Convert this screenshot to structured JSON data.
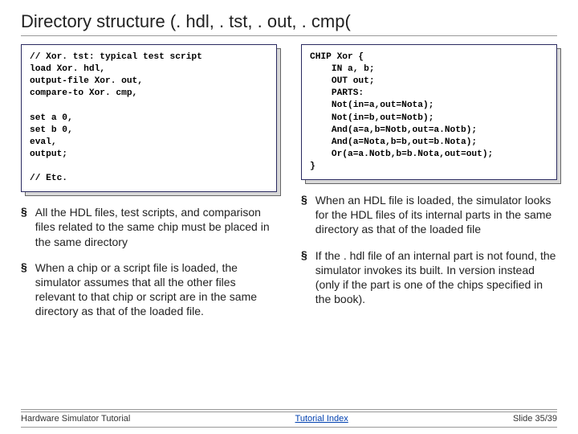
{
  "title": "Directory structure (. hdl, . tst, . out, . cmp(",
  "code_left": "// Xor. tst: typical test script\nload Xor. hdl,\noutput-file Xor. out,\ncompare-to Xor. cmp,\n\nset a 0,\nset b 0,\neval,\noutput;\n\n// Etc.",
  "code_right": "CHIP Xor {\n    IN a, b;\n    OUT out;\n    PARTS:\n    Not(in=a,out=Nota);\n    Not(in=b,out=Notb);\n    And(a=a,b=Notb,out=a.Notb);\n    And(a=Nota,b=b,out=b.Nota);\n    Or(a=a.Notb,b=b.Nota,out=out);\n}",
  "bullets_left": [
    "All the HDL files, test scripts, and comparison files related to the same chip must be placed in the same directory",
    "When a chip or a script file is loaded, the simulator assumes that all the other files relevant to that chip or script are in the same directory as that of the loaded file."
  ],
  "bullets_right": [
    "When an HDL file is loaded, the simulator looks for the HDL files of its internal parts in the same directory as that of the loaded file",
    "If the . hdl file of an internal part is not found, the simulator invokes its built. In version instead (only if the part is one of the chips specified in the book)."
  ],
  "footer": {
    "left": "Hardware Simulator Tutorial",
    "center": "Tutorial Index",
    "right": "Slide 35/39"
  },
  "chart_data": null
}
